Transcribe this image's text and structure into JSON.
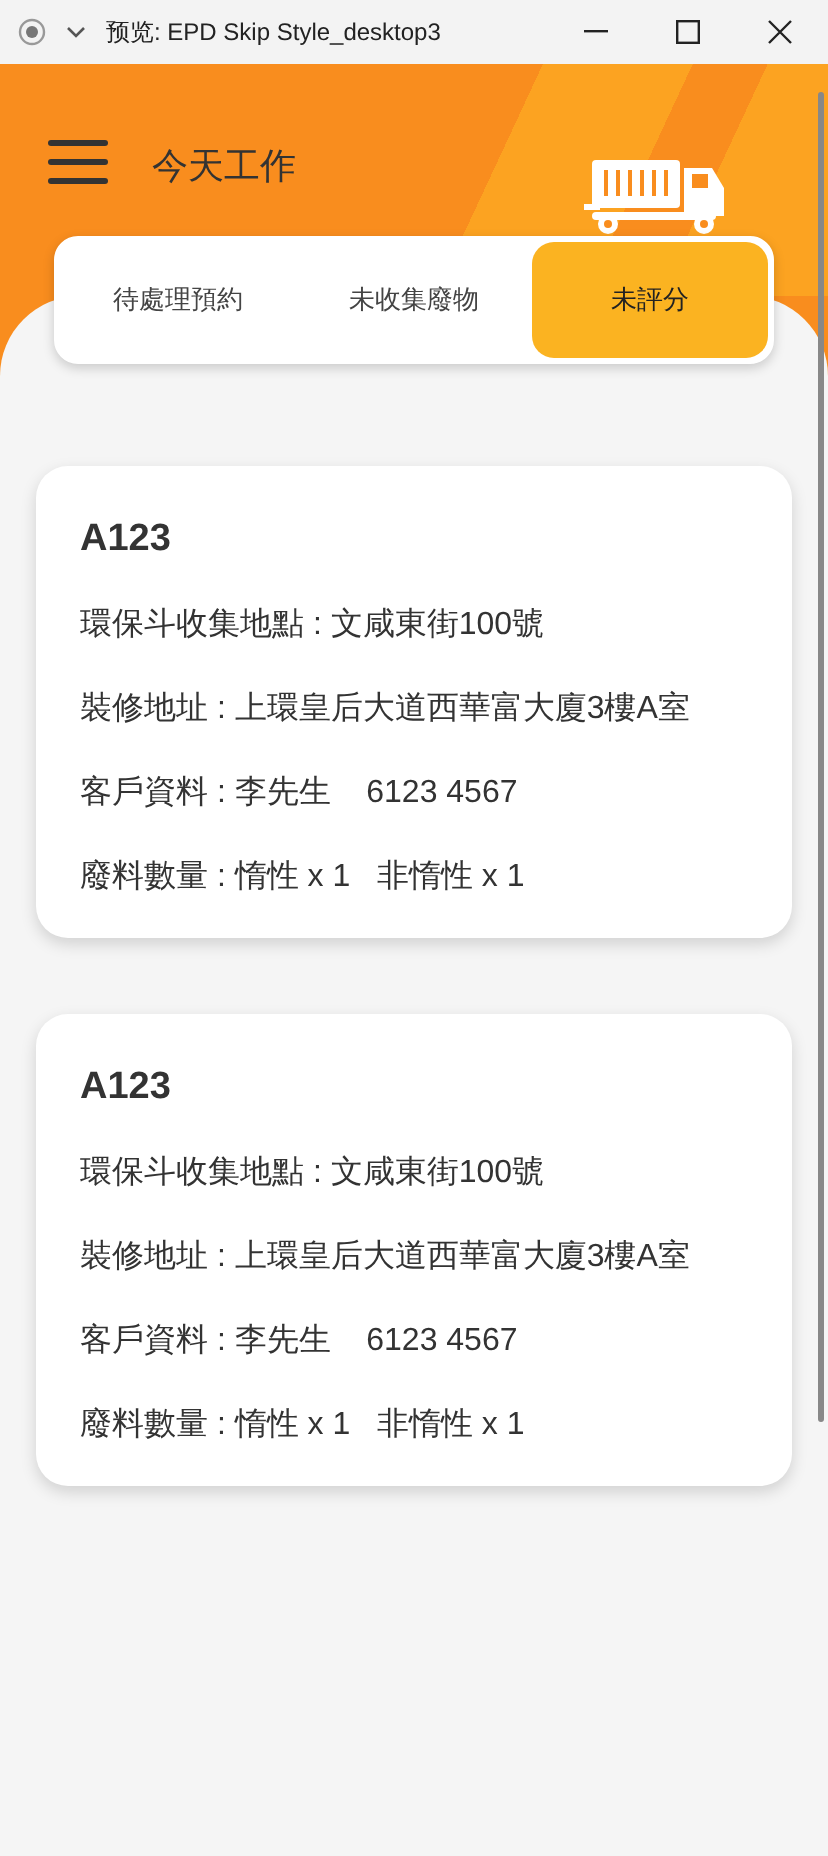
{
  "window": {
    "title": "预览: EPD Skip Style_desktop3"
  },
  "header": {
    "title": "今天工作"
  },
  "tabs": [
    {
      "label": "待處理預約",
      "selected": false
    },
    {
      "label": "未收集廢物",
      "selected": false
    },
    {
      "label": "未評分",
      "selected": true
    }
  ],
  "jobs": [
    {
      "code": "A123",
      "lines": [
        "環保斗收集地點 : 文咸東街100號",
        "裝修地址 : 上環皇后大道西華富大廈3樓A室",
        "客戶資料 : 李先生    6123 4567",
        "廢料數量 : 惰性 x 1   非惰性 x 1"
      ]
    },
    {
      "code": "A123",
      "lines": [
        "環保斗收集地點 : 文咸東街100號",
        "裝修地址 : 上環皇后大道西華富大廈3樓A室",
        "客戶資料 : 李先生    6123 4567",
        "廢料數量 : 惰性 x 1   非惰性 x 1"
      ]
    }
  ]
}
